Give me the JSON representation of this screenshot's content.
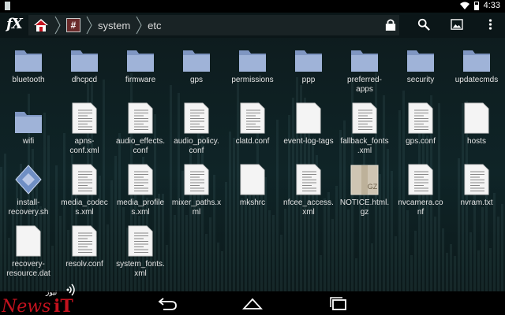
{
  "status_bar": {
    "time": "4:33"
  },
  "action_bar": {
    "logo_text": "fX",
    "breadcrumbs": [
      {
        "label": "system"
      },
      {
        "label": "etc"
      }
    ],
    "root_badge": "#"
  },
  "files": [
    {
      "name": "bluetooth",
      "type": "folder"
    },
    {
      "name": "dhcpcd",
      "type": "folder"
    },
    {
      "name": "firmware",
      "type": "folder"
    },
    {
      "name": "gps",
      "type": "folder"
    },
    {
      "name": "permissions",
      "type": "folder"
    },
    {
      "name": "ppp",
      "type": "folder"
    },
    {
      "name": "preferred-\napps",
      "type": "folder"
    },
    {
      "name": "security",
      "type": "folder"
    },
    {
      "name": "updatecmds",
      "type": "folder"
    },
    {
      "name": "wifi",
      "type": "folder"
    },
    {
      "name": "apns-\nconf.xml",
      "type": "text"
    },
    {
      "name": "audio_effects.\nconf",
      "type": "text"
    },
    {
      "name": "audio_policy.\nconf",
      "type": "text"
    },
    {
      "name": "clatd.conf",
      "type": "text"
    },
    {
      "name": "event-log-tags",
      "type": "blank"
    },
    {
      "name": "fallback_fonts\n.xml",
      "type": "text"
    },
    {
      "name": "gps.conf",
      "type": "text"
    },
    {
      "name": "hosts",
      "type": "blank"
    },
    {
      "name": "install-\nrecovery.sh",
      "type": "script"
    },
    {
      "name": "media_codec\ns.xml",
      "type": "text"
    },
    {
      "name": "media_profile\ns.xml",
      "type": "text"
    },
    {
      "name": "mixer_paths.x\nml",
      "type": "text"
    },
    {
      "name": "mkshrc",
      "type": "blank"
    },
    {
      "name": "nfcee_access.\nxml",
      "type": "text"
    },
    {
      "name": "NOTICE.html.\ngz",
      "type": "archive",
      "badge": "GZ"
    },
    {
      "name": "nvcamera.co\nnf",
      "type": "text"
    },
    {
      "name": "nvram.txt",
      "type": "text"
    },
    {
      "name": "recovery-\nresource.dat",
      "type": "blank"
    },
    {
      "name": "resolv.conf",
      "type": "text"
    },
    {
      "name": "system_fonts.\nxml",
      "type": "text"
    }
  ],
  "watermark": {
    "text": "News iT",
    "arabic": "نیوز"
  },
  "colors": {
    "folder": "#9fb3d8",
    "folder_dark": "#7f96c2",
    "doc": "#f4f4f4",
    "accent_red": "#c3121e"
  },
  "icons": [
    "home-icon",
    "lock-icon",
    "search-icon",
    "image-icon",
    "overflow-menu-icon",
    "back-icon",
    "home-nav-icon",
    "recents-icon"
  ]
}
